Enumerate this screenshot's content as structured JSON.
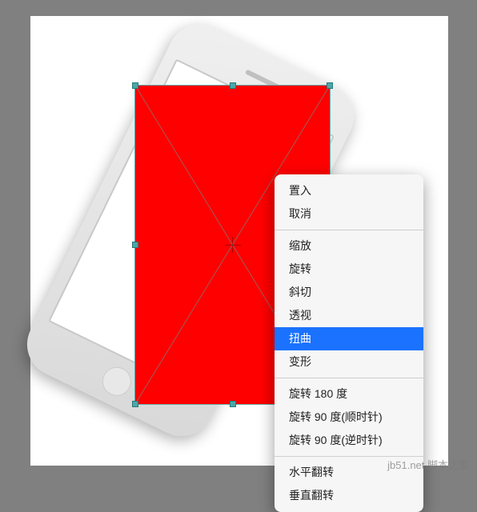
{
  "colors": {
    "background": "#808080",
    "canvas_fill": "#ffffff",
    "selection_fill": "#ff0000",
    "handle_fill": "#4aa8a8",
    "menu_highlight": "#1a72ff"
  },
  "context_menu": {
    "groups": [
      [
        {
          "key": "place",
          "label": "置入"
        },
        {
          "key": "cancel",
          "label": "取消"
        }
      ],
      [
        {
          "key": "scale",
          "label": "缩放"
        },
        {
          "key": "rotate",
          "label": "旋转"
        },
        {
          "key": "skew",
          "label": "斜切"
        },
        {
          "key": "perspective",
          "label": "透视"
        },
        {
          "key": "distort",
          "label": "扭曲",
          "highlighted": true
        },
        {
          "key": "warp",
          "label": "变形"
        }
      ],
      [
        {
          "key": "rotate-180",
          "label": "旋转 180 度"
        },
        {
          "key": "rotate-90-cw",
          "label": "旋转 90 度(顺时针)"
        },
        {
          "key": "rotate-90-ccw",
          "label": "旋转 90 度(逆时针)"
        }
      ],
      [
        {
          "key": "flip-horizontal",
          "label": "水平翻转"
        },
        {
          "key": "flip-vertical",
          "label": "垂直翻转"
        }
      ]
    ]
  },
  "watermark": "jb51.net  脚本之家"
}
